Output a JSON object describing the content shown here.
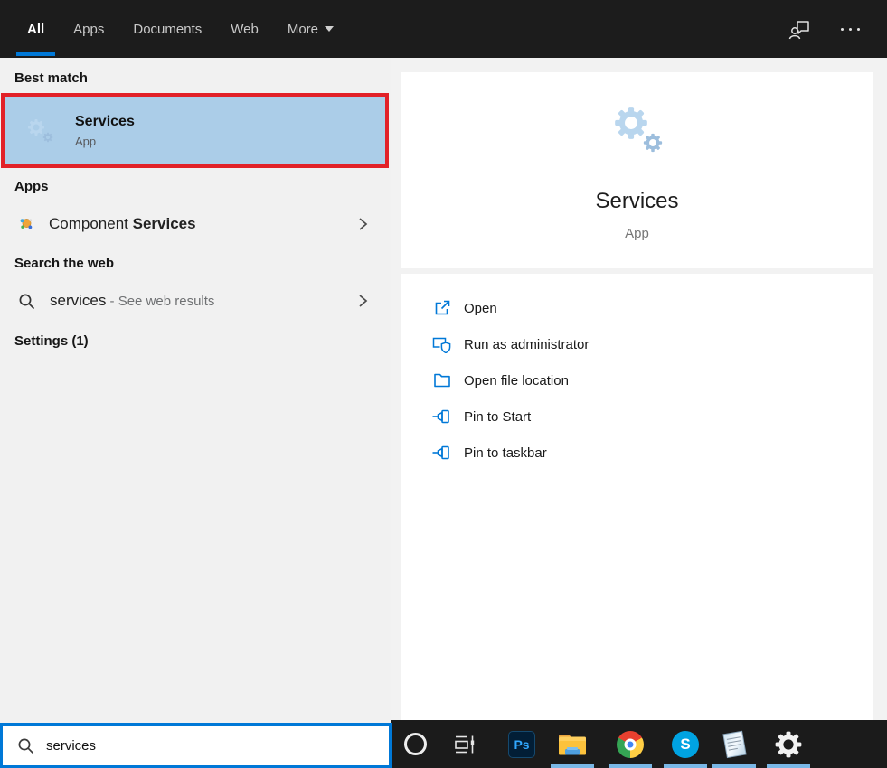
{
  "topbar": {
    "tabs": [
      {
        "label": "All",
        "active": true
      },
      {
        "label": "Apps",
        "active": false
      },
      {
        "label": "Documents",
        "active": false
      },
      {
        "label": "Web",
        "active": false
      },
      {
        "label": "More",
        "active": false,
        "has_dropdown": true
      }
    ],
    "right_icons": [
      "feedback-icon",
      "ellipsis-icon"
    ]
  },
  "left_panel": {
    "best_match_label": "Best match",
    "best_match_item": {
      "title": "Services",
      "subtitle": "App",
      "icon": "services-gears-icon",
      "annotated": true
    },
    "apps_label": "Apps",
    "apps_item": {
      "prefix": "Component ",
      "match": "Services",
      "icon": "component-services-icon",
      "chevron": true
    },
    "search_web_label": "Search the web",
    "web_item": {
      "query": "services",
      "suffix": " - See web results",
      "icon": "search-icon",
      "chevron": true
    },
    "settings_label": "Settings (1)"
  },
  "preview": {
    "icon": "services-gears-icon",
    "title": "Services",
    "subtitle": "App",
    "actions": [
      {
        "label": "Open",
        "icon": "open-icon"
      },
      {
        "label": "Run as administrator",
        "icon": "admin-shield-icon"
      },
      {
        "label": "Open file location",
        "icon": "folder-icon"
      },
      {
        "label": "Pin to Start",
        "icon": "pin-icon"
      },
      {
        "label": "Pin to taskbar",
        "icon": "pin-icon"
      }
    ]
  },
  "search_box": {
    "value": "services",
    "icon": "search-icon"
  },
  "taskbar": {
    "icons": [
      "cortana-icon",
      "task-view-icon",
      "photoshop-icon",
      "file-explorer-icon",
      "chrome-icon",
      "skype-icon",
      "notepad-icon",
      "settings-gear-icon"
    ],
    "photoshop_label": "Ps",
    "skype_label": "S",
    "running_indicators": [
      "file-explorer",
      "chrome",
      "skype",
      "notepad",
      "settings"
    ]
  },
  "colors": {
    "accent_blue": "#0078d7",
    "highlight_blue": "#abcde8",
    "annotation_red": "#e22128",
    "topbar_bg": "#1c1c1c",
    "panel_bg": "#f1f1f1",
    "action_icon_blue": "#0078d7",
    "running_indicator": "#79b7e6"
  }
}
